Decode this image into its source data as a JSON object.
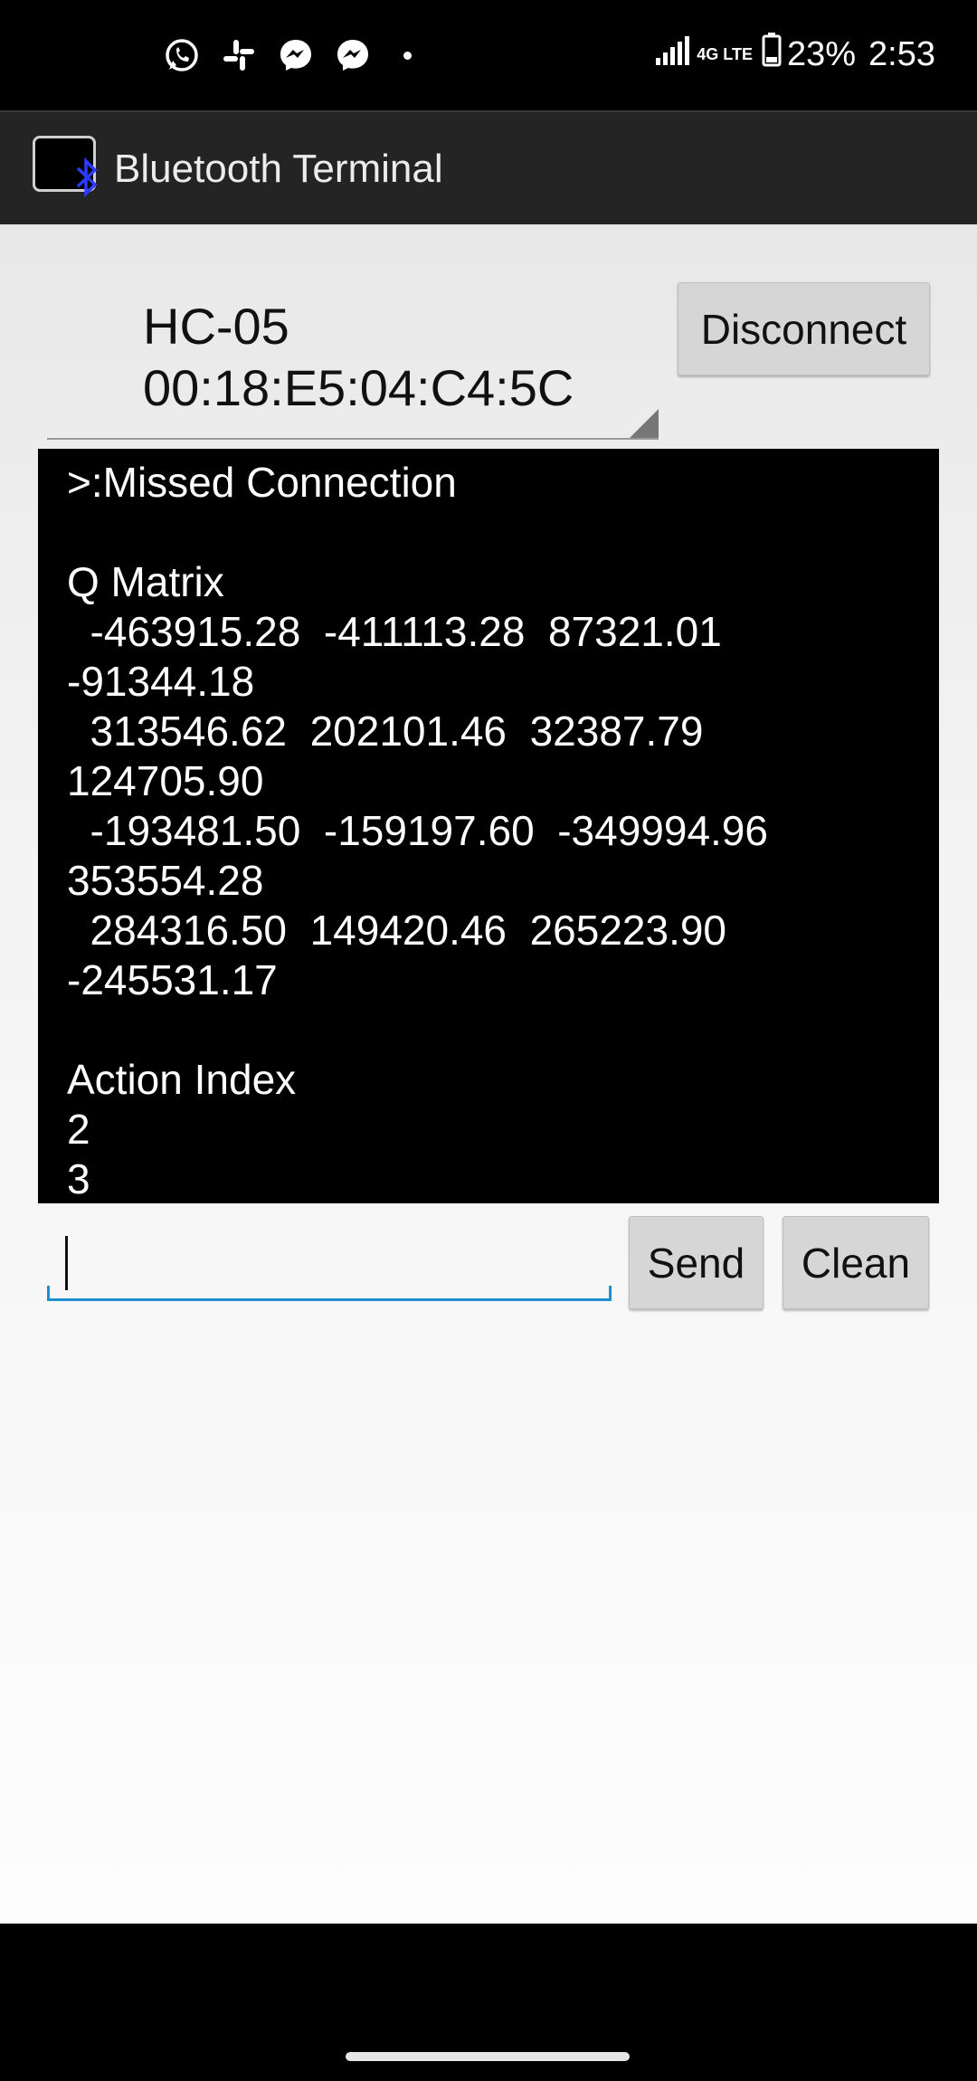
{
  "status_bar": {
    "notifications": [
      "whatsapp-icon",
      "slack-icon",
      "messenger-icon",
      "messenger-icon",
      "more-dot"
    ],
    "network": "4G LTE",
    "battery": "23%",
    "time": "2:53"
  },
  "app_bar": {
    "title": "Bluetooth Terminal",
    "icon_label": "Bluetooth Terminal"
  },
  "device": {
    "name": "HC-05",
    "address": "00:18:E5:04:C4:5C"
  },
  "buttons": {
    "disconnect": "Disconnect",
    "send": "Send",
    "clean": "Clean"
  },
  "terminal": {
    "lines": [
      ">:Missed Connection",
      "",
      "Q Matrix",
      "  -463915.28  -411113.28  87321.01",
      "-91344.18",
      "  313546.62  202101.46  32387.79",
      "124705.90",
      "  -193481.50  -159197.60  -349994.96",
      "353554.28",
      "  284316.50  149420.46  265223.90",
      "-245531.17",
      "",
      "Action Index",
      "2",
      "3"
    ]
  },
  "input": {
    "value": ""
  },
  "colors": {
    "accent": "#1f8fd1",
    "terminal_bg": "#000000",
    "action_bar": "#242424",
    "bluetooth": "#2b3bff"
  }
}
